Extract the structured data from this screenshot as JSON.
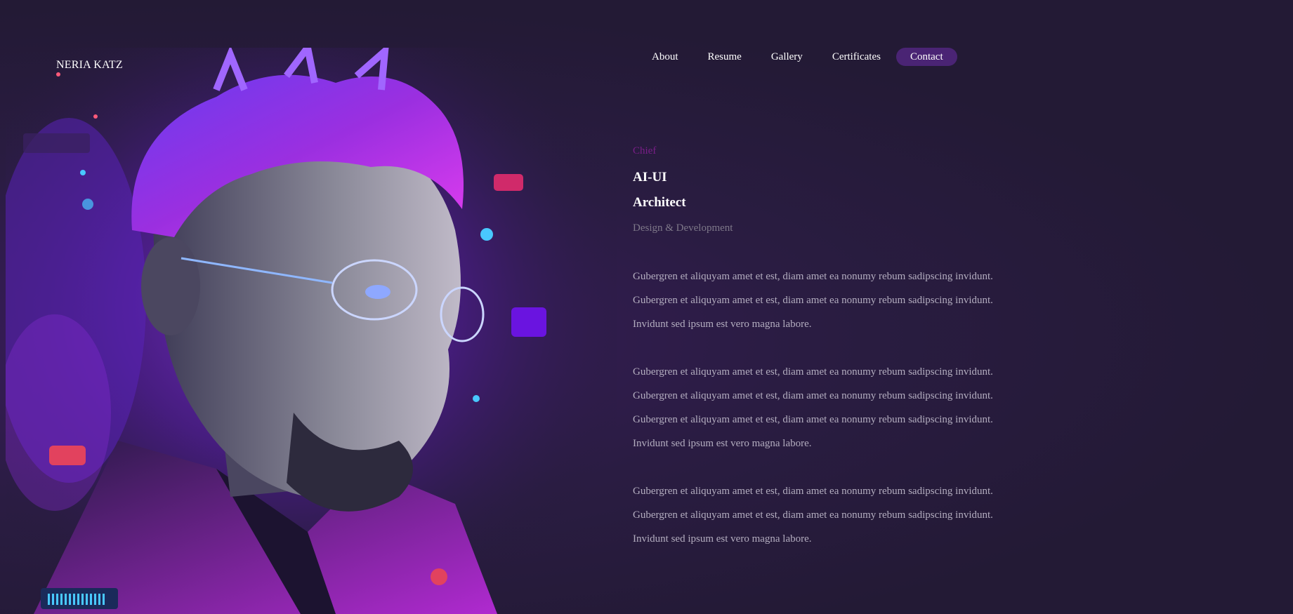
{
  "brand": {
    "name": "NERIA KATZ"
  },
  "nav": {
    "items": [
      {
        "label": "About"
      },
      {
        "label": "Resume"
      },
      {
        "label": "Gallery"
      },
      {
        "label": "Certificates"
      },
      {
        "label": "Contact",
        "active": true
      }
    ]
  },
  "hero": {
    "eyebrow": "Chief",
    "title_line1": "AI-UI",
    "title_line2": "Architect",
    "subtitle": "Design & Development"
  },
  "paragraphs": [
    {
      "lines": [
        "Gubergren et aliquyam amet et est, diam amet ea nonumy rebum sadipscing invidunt.",
        "Gubergren et aliquyam amet et est, diam amet ea nonumy rebum sadipscing invidunt.",
        "Invidunt sed ipsum est vero magna labore."
      ]
    },
    {
      "lines": [
        "Gubergren et aliquyam amet et est, diam amet ea nonumy rebum sadipscing invidunt.",
        "Gubergren et aliquyam amet et est, diam amet ea nonumy rebum sadipscing invidunt.",
        "Gubergren et aliquyam amet et est, diam amet ea nonumy rebum sadipscing invidunt.",
        "Invidunt sed ipsum est vero magna labore."
      ]
    },
    {
      "lines": [
        "Gubergren et aliquyam amet et est, diam amet ea nonumy rebum sadipscing invidunt.",
        "Gubergren et aliquyam amet et est, diam amet ea nonumy rebum sadipscing invidunt.",
        "Invidunt sed ipsum est vero magna labore."
      ]
    }
  ],
  "colors": {
    "background": "#231a35",
    "accent_active": "#4a2474",
    "eyebrow": "#7a1e88",
    "body_text": "#b3adbf"
  },
  "icons": [
    "portrait-illustration"
  ]
}
